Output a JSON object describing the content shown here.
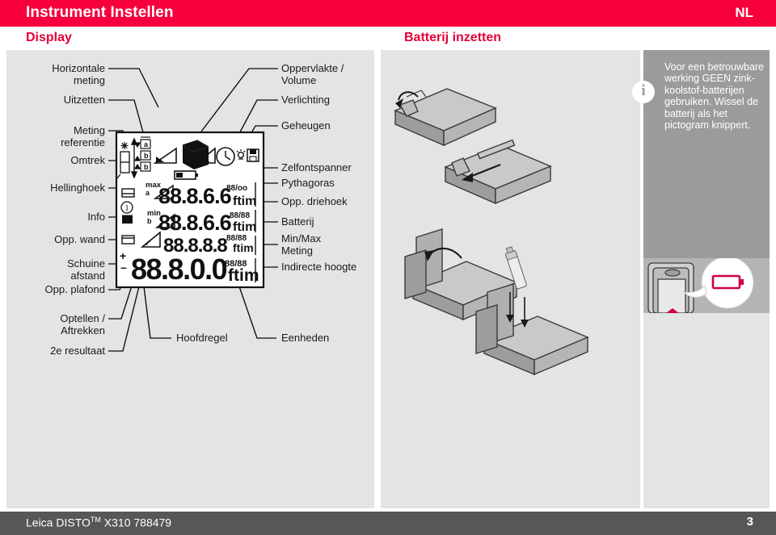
{
  "header": {
    "title": "Instrument Instellen",
    "language": "NL"
  },
  "sections": {
    "display_heading": "Display",
    "battery_heading": "Batterij inzetten"
  },
  "diagram": {
    "left_labels": [
      {
        "id": "horizontale-meting",
        "text": "Horizontale\nmeting"
      },
      {
        "id": "uitzetten",
        "text": "Uitzetten"
      },
      {
        "id": "meting-referentie",
        "text": "Meting\nreferentie"
      },
      {
        "id": "omtrek",
        "text": "Omtrek"
      },
      {
        "id": "hellinghoek",
        "text": "Hellinghoek"
      },
      {
        "id": "info",
        "text": "Info"
      },
      {
        "id": "opp-wand",
        "text": "Opp. wand"
      },
      {
        "id": "schuine-afstand",
        "text": "Schuine\nafstand"
      },
      {
        "id": "opp-plafond",
        "text": "Opp. plafond"
      },
      {
        "id": "optellen-aftrekken",
        "text": "Optellen /\nAftrekken"
      },
      {
        "id": "2e-resultaat",
        "text": "2e resultaat"
      }
    ],
    "right_labels": [
      {
        "id": "oppervlakte-volume",
        "text": "Oppervlakte /\nVolume"
      },
      {
        "id": "verlichting",
        "text": "Verlichting"
      },
      {
        "id": "geheugen",
        "text": "Geheugen"
      },
      {
        "id": "zelfontspanner",
        "text": "Zelfontspanner"
      },
      {
        "id": "pythagoras",
        "text": "Pythagoras"
      },
      {
        "id": "opp-driehoek",
        "text": "Opp. driehoek"
      },
      {
        "id": "batterij",
        "text": "Batterij"
      },
      {
        "id": "min-max-meting",
        "text": "Min/Max\nMeting"
      },
      {
        "id": "indirecte-hoogte",
        "text": "Indirecte hoogte"
      }
    ],
    "bottom_labels": [
      {
        "id": "hoofdregel",
        "text": "Hoofdregel"
      },
      {
        "id": "eenheden",
        "text": "Eenheden"
      }
    ],
    "lcd": {
      "row1_digits": "88.8.6.6",
      "row2_digits": "88.8.6.6",
      "row3_digits": "88.8.8.8",
      "row_main_digits": "88.8.0.0",
      "unit_text": "ftim",
      "small_unit_1": "88/oo",
      "small_unit_2": "88/88",
      "small_unit_3": "88/88",
      "small_unit_main": "88/88",
      "max_label": "max",
      "min_label": "min",
      "a_label": "a",
      "b_label": "b",
      "plus_sign": "+",
      "minus_sign": "-"
    }
  },
  "battery": {
    "info_text": "Voor een betrouwbare werking GEEN zink-koolstof-batterijen gebruiken. Wissel de batterij als het pictogram knippert.",
    "info_icon": "info-circle-icon",
    "battery_icon": "battery-low-icon"
  },
  "footer": {
    "product": "Leica DISTO",
    "trademark": "TM",
    "model": " X310 788479",
    "page_number": "3"
  },
  "colors": {
    "brand_red": "#f5003c",
    "heading_red": "#e4003a",
    "panel_gray": "#e3e4e5",
    "info_gray": "#9b9b9b",
    "footer_gray": "#575757"
  }
}
